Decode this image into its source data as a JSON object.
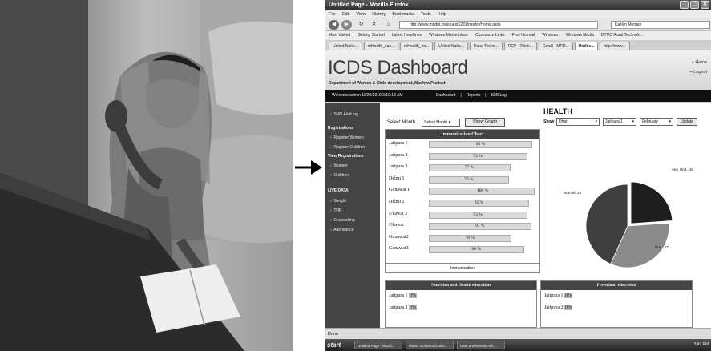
{
  "browser": {
    "window_title": "Untitled Page - Mozilla Firefox",
    "menu": [
      "File",
      "Edit",
      "View",
      "History",
      "Bookmarks",
      "Tools",
      "Help"
    ],
    "url": "http://www.mpdot.org/guest1231/mpdot/Home.aspx",
    "search_user": "Kaitlyn Morgan",
    "bookmarks": [
      "Most Visited",
      "Getting Started",
      "Latest Headlines",
      "Windows Marketplace",
      "Customize Links",
      "Free Hotmail",
      "Windows",
      "Windows Media",
      "DTMS Rural Technolo..."
    ],
    "tabs": [
      "United Natio...",
      "mHealth_cas...",
      "mHealth_for...",
      "United Natio...",
      "Rural Techn...",
      "RCP - Think...",
      "Gmail - MPD...",
      "Untitle...",
      "http://www..."
    ],
    "status": "Done"
  },
  "app": {
    "logo": "ICDS Dashboard",
    "department": "Department of Women & Child development, Madhya Pradesh",
    "home_link": "Home",
    "logout_link": "Logout",
    "welcome": "Welcome admin  11/30/2010 3:10:13 AM",
    "topnav": [
      "Dashboard",
      "|",
      "Reports",
      "|",
      "SMSLog"
    ]
  },
  "sidebar": {
    "sms_alert": "SMS Alert log",
    "registrations_head": "Registrations",
    "register_women": "Register Women",
    "register_children": "Register Children",
    "view_head": "View Registrations",
    "women": "Women",
    "children": "Children",
    "live_head": "LIVE DATA",
    "weight": "Weight",
    "thr": "THR",
    "counselling": "Counselling",
    "attendance": "Attendance"
  },
  "filters": {
    "select_month_label": "Select Month",
    "select_month_value": "Select Month",
    "show_graph": "Show Graph"
  },
  "immunization": {
    "title": "Immunization Chart",
    "footer": "Immunization",
    "rows": [
      {
        "name": "Jaitpura 1",
        "value": 98,
        "text": "98 %"
      },
      {
        "name": "Jaitpura 2",
        "value": 93,
        "text": "93 %"
      },
      {
        "name": "Jaitpura 3",
        "value": 77,
        "text": "77 %"
      },
      {
        "name": "Delmi 1",
        "value": 76,
        "text": "76 %"
      },
      {
        "name": "Gunawat 1",
        "value": 100,
        "text": "100 %"
      },
      {
        "name": "Delmi 2",
        "value": 95,
        "text": "95 %"
      },
      {
        "name": "Ukawat 2",
        "value": 93,
        "text": "93 %"
      },
      {
        "name": "Ukawat 1",
        "value": 97,
        "text": "97 %"
      },
      {
        "name": "Gunawat2",
        "value": 78,
        "text": "78 %"
      },
      {
        "name": "Gunawat3",
        "value": 90,
        "text": "90 %"
      }
    ]
  },
  "health": {
    "title": "HEALTH",
    "show_label": "Show",
    "district": "Dhar",
    "center": "Jaitpura 1",
    "month": "February",
    "update": "Update"
  },
  "chart_data": {
    "type": "pie",
    "title": "",
    "slices": [
      {
        "label": "Normal, 29",
        "value": 29,
        "color": "#3f3f3f"
      },
      {
        "label": "Sev. Und., 16",
        "value": 16,
        "color": "#1e1e1e"
      },
      {
        "label": "Und., 22",
        "value": 22,
        "color": "#8a8a8a"
      }
    ]
  },
  "nutrition": {
    "title": "Nutrition and Health education",
    "rows": [
      {
        "name": "Jaitpura 1",
        "pct": "0%"
      },
      {
        "name": "Jaitpura 2",
        "pct": "0%"
      }
    ]
  },
  "preschool": {
    "title": "Pre-school education",
    "rows": [
      {
        "name": "Jaitpura 1",
        "pct": "0%"
      },
      {
        "name": "Jaitpura 2",
        "pct": "0%"
      }
    ]
  },
  "taskbar": {
    "start": "start",
    "tasks": [
      "Untitled Page - Mozill...",
      "Music: Bollywood Mus...",
      "User preferences wh..."
    ],
    "clock": "3:42 PM"
  }
}
